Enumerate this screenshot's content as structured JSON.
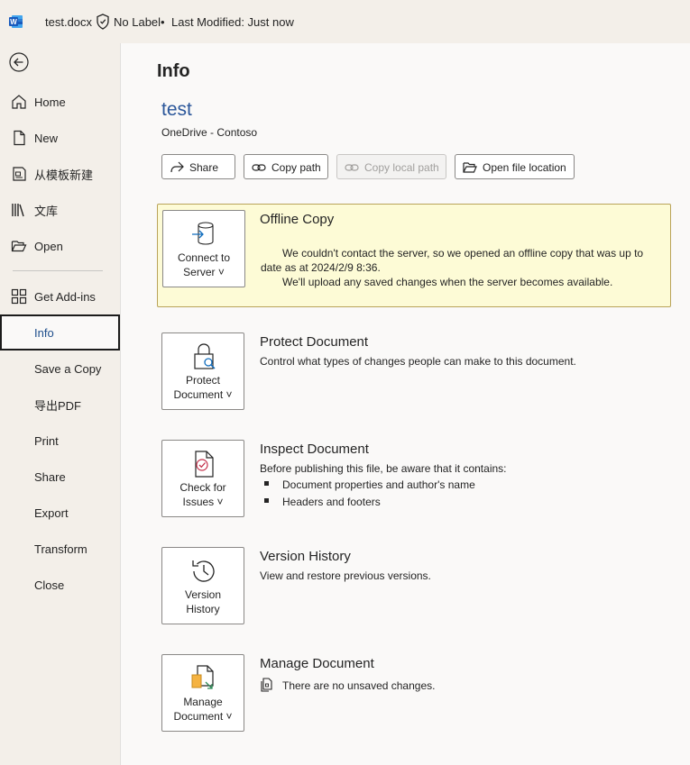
{
  "titlebar": {
    "file_name": "test.docx",
    "label": "No Label",
    "separator": "•",
    "modified": "Last Modified: Just now"
  },
  "sidebar": {
    "items": [
      {
        "label": "Home",
        "icon": "home-icon"
      },
      {
        "label": "New",
        "icon": "new-document-icon"
      },
      {
        "label": "从模板新建",
        "icon": "template-icon"
      },
      {
        "label": "文库",
        "icon": "library-icon"
      },
      {
        "label": "Open",
        "icon": "folder-open-icon"
      },
      {
        "label": "Get Add-ins",
        "icon": "add-ins-icon"
      },
      {
        "label": "Info"
      },
      {
        "label": "Save a Copy"
      },
      {
        "label": "导出PDF"
      },
      {
        "label": "Print"
      },
      {
        "label": "Share"
      },
      {
        "label": "Export"
      },
      {
        "label": "Transform"
      },
      {
        "label": "Close"
      }
    ],
    "active": "Info"
  },
  "main": {
    "title": "Info",
    "doc_name": "test",
    "doc_location": "OneDrive - Contoso",
    "actions": [
      {
        "label": "Share",
        "icon": "share-icon",
        "enabled": true
      },
      {
        "label": "Copy path",
        "icon": "link-icon",
        "enabled": true
      },
      {
        "label": "Copy local path",
        "icon": "link-icon",
        "enabled": false
      },
      {
        "label": "Open file location",
        "icon": "folder-icon",
        "enabled": true
      }
    ],
    "offline": {
      "button_line1": "Connect to",
      "button_line2": "Server ˅",
      "title": "Offline Copy",
      "message1": "We couldn't contact the server, so we opened an offline copy that was up to date as at 2024/2/9 8:36.",
      "message2": "We'll upload any saved changes when the server becomes available."
    },
    "protect": {
      "button_line1": "Protect",
      "button_line2": "Document ˅",
      "title": "Protect Document",
      "desc": "Control what types of changes people can make to this document."
    },
    "inspect": {
      "button_line1": "Check for",
      "button_line2": "Issues ˅",
      "title": "Inspect Document",
      "desc": "Before publishing this file, be aware that it contains:",
      "bullets": [
        "Document properties and author's name",
        "Headers and footers"
      ]
    },
    "version": {
      "button_line1": "Version",
      "button_line2": "History",
      "title": "Version History",
      "desc": "View and restore previous versions."
    },
    "manage": {
      "button_line1": "Manage",
      "button_line2": "Document ˅",
      "title": "Manage Document",
      "desc": "There are no unsaved changes."
    }
  },
  "colors": {
    "accent": "#2b579a",
    "offline_bg": "#fdfbd6",
    "offline_border": "#b9a35a"
  }
}
